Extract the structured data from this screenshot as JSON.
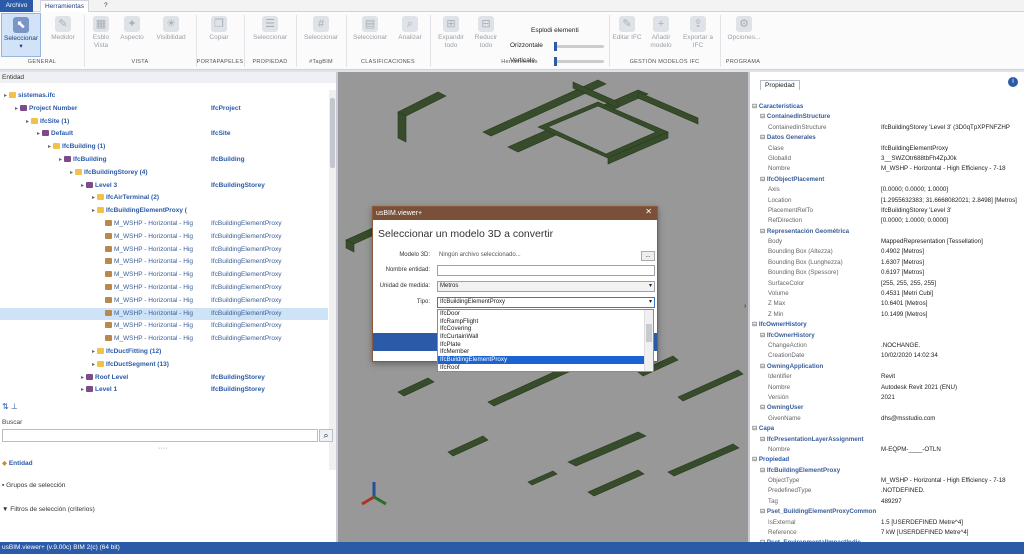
{
  "tabs": {
    "file": "Archivo",
    "tools": "Herramientas",
    "help": "?"
  },
  "ribbon": {
    "buttons": [
      {
        "label": "Seleccionar",
        "icon": "pointer-icon"
      },
      {
        "label": "Medidor",
        "icon": "ruler-icon"
      },
      {
        "label": "Esblo Vista",
        "icon": "eye-icon"
      },
      {
        "label": "Aspecto",
        "icon": "paint-icon"
      },
      {
        "label": "Visibilidad",
        "icon": "bulb-icon"
      },
      {
        "label": "Copiar",
        "icon": "copy-icon"
      },
      {
        "label": "Seleccionar",
        "icon": "list-icon"
      },
      {
        "label": "Seleccionar",
        "icon": "hash-icon"
      },
      {
        "label": "Seleccionar",
        "icon": "filter-icon"
      },
      {
        "label": "Analizar",
        "icon": "analyze-icon"
      },
      {
        "label": "Expandir todo",
        "icon": "expand-icon"
      },
      {
        "label": "Reducir todo",
        "icon": "collapse-icon"
      },
      {
        "label": "Editar IFC",
        "icon": "edit-icon"
      },
      {
        "label": "Añadir modelo",
        "icon": "add-model-icon"
      },
      {
        "label": "Exportar a IFC",
        "icon": "export-icon"
      },
      {
        "label": "Opciones...",
        "icon": "gear-icon"
      }
    ],
    "groups": [
      "GENERAL",
      "VISTA",
      "PORTAPAPELES",
      "PROPIEDAD",
      "#TagBIM",
      "CLASIFICACIONES",
      "Herramientas",
      "GESTIÓN MODELOS IFC",
      "PROGRAMA"
    ],
    "explode": {
      "title": "Esplodi elementi",
      "horizontal": "Orizzontale",
      "vertical": "Verticale"
    }
  },
  "left": {
    "header": "Entidad",
    "tree": [
      {
        "name": "sistemas.ifc",
        "type": "",
        "level": 0,
        "icon": "folder"
      },
      {
        "name": "Project Number",
        "type": "IfcProject",
        "level": 1,
        "icon": "project"
      },
      {
        "name": "IfcSite (1)",
        "type": "",
        "level": 2,
        "icon": "folder"
      },
      {
        "name": "Default",
        "type": "IfcSite",
        "level": 3,
        "icon": "project"
      },
      {
        "name": "IfcBuilding (1)",
        "type": "",
        "level": 4,
        "icon": "folder"
      },
      {
        "name": "IfcBuilding",
        "type": "IfcBuilding",
        "level": 5,
        "icon": "project"
      },
      {
        "name": "IfcBuildingStorey (4)",
        "type": "",
        "level": 6,
        "icon": "folder"
      },
      {
        "name": "Level 3",
        "type": "IfcBuildingStorey",
        "level": 7,
        "icon": "project"
      },
      {
        "name": "IfcAirTerminal (2)",
        "type": "",
        "level": 8,
        "icon": "folder"
      },
      {
        "name": "IfcBuildingElementProxy (",
        "type": "",
        "level": 8,
        "icon": "folder"
      },
      {
        "name": "M_WSHP - Horizontal - Hig",
        "type": "IfcBuildingElementProxy",
        "level": 9,
        "icon": "bldg"
      },
      {
        "name": "M_WSHP - Horizontal - Hig",
        "type": "IfcBuildingElementProxy",
        "level": 9,
        "icon": "bldg"
      },
      {
        "name": "M_WSHP - Horizontal - Hig",
        "type": "IfcBuildingElementProxy",
        "level": 9,
        "icon": "bldg"
      },
      {
        "name": "M_WSHP - Horizontal - Hig",
        "type": "IfcBuildingElementProxy",
        "level": 9,
        "icon": "bldg"
      },
      {
        "name": "M_WSHP - Horizontal - Hig",
        "type": "IfcBuildingElementProxy",
        "level": 9,
        "icon": "bldg"
      },
      {
        "name": "M_WSHP - Horizontal - Hig",
        "type": "IfcBuildingElementProxy",
        "level": 9,
        "icon": "bldg"
      },
      {
        "name": "M_WSHP - Horizontal - Hig",
        "type": "IfcBuildingElementProxy",
        "level": 9,
        "icon": "bldg"
      },
      {
        "name": "M_WSHP - Horizontal - Hig",
        "type": "IfcBuildingElementProxy",
        "level": 9,
        "icon": "bldg"
      },
      {
        "name": "M_WSHP - Horizontal - Hig",
        "type": "IfcBuildingElementProxy",
        "level": 9,
        "icon": "bldg"
      },
      {
        "name": "M_WSHP - Horizontal - Hig",
        "type": "IfcBuildingElementProxy",
        "level": 9,
        "icon": "bldg"
      },
      {
        "name": "IfcDuctFitting (12)",
        "type": "",
        "level": 8,
        "icon": "folder"
      },
      {
        "name": "IfcDuctSegment (13)",
        "type": "",
        "level": 8,
        "icon": "folder"
      },
      {
        "name": "Roof Level",
        "type": "IfcBuildingStorey",
        "level": 7,
        "icon": "project"
      },
      {
        "name": "Level 1",
        "type": "IfcBuildingStorey",
        "level": 7,
        "icon": "project"
      }
    ],
    "search_label": "Buscar",
    "sections": [
      "Entidad",
      "Grupos de selección",
      "Filtros de selección (criterios)"
    ]
  },
  "right": {
    "tab": "Propiedad",
    "rows": [
      {
        "k": "Características",
        "v": "",
        "kind": "cat",
        "ind": 0
      },
      {
        "k": "ContainedInStructure",
        "v": "",
        "kind": "sub",
        "ind": 1
      },
      {
        "k": "ContainedInStructure",
        "v": "IfcBuildingStorey 'Level 3' (3D0qTpXPFNFZHP",
        "kind": "leaf",
        "ind": 2
      },
      {
        "k": "Datos Generales",
        "v": "",
        "kind": "sub",
        "ind": 1
      },
      {
        "k": "Clase",
        "v": "IfcBuildingElementProxy",
        "kind": "leaf",
        "ind": 2
      },
      {
        "k": "GlobalId",
        "v": "3__SWZOtr688tbFh4ZpJ0k",
        "kind": "leaf",
        "ind": 2
      },
      {
        "k": "Nombre",
        "v": "M_WSHP - Horizontal - High Efficiency - 7-18",
        "kind": "leaf",
        "ind": 2
      },
      {
        "k": "IfcObjectPlacement",
        "v": "",
        "kind": "sub",
        "ind": 1
      },
      {
        "k": "Axis",
        "v": "[0.0000; 0.0000; 1.0000]",
        "kind": "leaf",
        "ind": 2
      },
      {
        "k": "Location",
        "v": "[1.2955632383; 31.6668082021; 2.8498] [Metros]",
        "kind": "leaf",
        "ind": 2
      },
      {
        "k": "PlacementRelTo",
        "v": "IfcBuildingStorey 'Level 3'",
        "kind": "leaf",
        "ind": 2
      },
      {
        "k": "RefDirection",
        "v": "[0.0000; 1.0000; 0.0000]",
        "kind": "leaf",
        "ind": 2
      },
      {
        "k": "Representación Geométrica",
        "v": "",
        "kind": "sub",
        "ind": 1
      },
      {
        "k": "Body",
        "v": "MappedRepresentation [Tessellation]",
        "kind": "leaf",
        "ind": 2
      },
      {
        "k": "Bounding Box (Altezza)",
        "v": "0.4902 [Metros]",
        "kind": "leaf",
        "ind": 2
      },
      {
        "k": "Bounding Box (Lunghezza)",
        "v": "1.6307 [Metros]",
        "kind": "leaf",
        "ind": 2
      },
      {
        "k": "Bounding Box (Spessore)",
        "v": "0.6197 [Metros]",
        "kind": "leaf",
        "ind": 2
      },
      {
        "k": "SurfaceColor",
        "v": "[255, 255, 255, 255]",
        "kind": "leaf",
        "ind": 2
      },
      {
        "k": "Volume",
        "v": "0.4531 [Metri Cubi]",
        "kind": "leaf",
        "ind": 2
      },
      {
        "k": "Z Max",
        "v": "10.6401 [Metros]",
        "kind": "leaf",
        "ind": 2
      },
      {
        "k": "Z Min",
        "v": "10.1499 [Metros]",
        "kind": "leaf",
        "ind": 2
      },
      {
        "k": "IfcOwnerHistory",
        "v": "",
        "kind": "cat",
        "ind": 0
      },
      {
        "k": "IfcOwnerHistory",
        "v": "",
        "kind": "sub",
        "ind": 1
      },
      {
        "k": "ChangeAction",
        "v": ".NOCHANGE.",
        "kind": "leaf",
        "ind": 2
      },
      {
        "k": "CreationDate",
        "v": "10/02/2020 14:02:34",
        "kind": "leaf",
        "ind": 2
      },
      {
        "k": "OwningApplication",
        "v": "",
        "kind": "sub",
        "ind": 1
      },
      {
        "k": "Identifier",
        "v": "Revit",
        "kind": "leaf",
        "ind": 2
      },
      {
        "k": "Nombre",
        "v": "Autodesk Revit 2021 (ENU)",
        "kind": "leaf",
        "ind": 2
      },
      {
        "k": "Versión",
        "v": "2021",
        "kind": "leaf",
        "ind": 2
      },
      {
        "k": "OwningUser",
        "v": "",
        "kind": "sub",
        "ind": 1
      },
      {
        "k": "GivenName",
        "v": "dhs@msstudio.com",
        "kind": "leaf",
        "ind": 2
      },
      {
        "k": "Capa",
        "v": "",
        "kind": "cat",
        "ind": 0
      },
      {
        "k": "IfcPresentationLayerAssignment",
        "v": "",
        "kind": "sub",
        "ind": 1
      },
      {
        "k": "Nombre",
        "v": "M-EQPM-____-OTLN",
        "kind": "leaf",
        "ind": 2
      },
      {
        "k": "Propiedad",
        "v": "",
        "kind": "cat",
        "ind": 0
      },
      {
        "k": "IfcBuildingElementProxy",
        "v": "",
        "kind": "sub",
        "ind": 1
      },
      {
        "k": "ObjectType",
        "v": "M_WSHP - Horizontal - High Efficiency - 7-18",
        "kind": "leaf",
        "ind": 2
      },
      {
        "k": "PredefinedType",
        "v": ".NOTDEFINED.",
        "kind": "leaf",
        "ind": 2
      },
      {
        "k": "Tag",
        "v": "489297",
        "kind": "leaf",
        "ind": 2
      },
      {
        "k": "Pset_BuildingElementProxyCommon",
        "v": "",
        "kind": "sub",
        "ind": 1
      },
      {
        "k": "IsExternal",
        "v": "1.5 [USERDEFINED Metre^4]",
        "kind": "leaf",
        "ind": 2
      },
      {
        "k": "Reference",
        "v": "7 kW [USERDEFINED Metre^4]",
        "kind": "leaf",
        "ind": 2
      },
      {
        "k": "Pset_EnvironmentalImpactIndic",
        "v": "",
        "kind": "sub",
        "ind": 1
      }
    ]
  },
  "dialog": {
    "title": "usBIM.viewer+",
    "heading": "Seleccionar un modelo 3D a convertir",
    "model_label": "Modelo 3D:",
    "model_value": "Ningún archivo seleccionado...",
    "browse": "...",
    "name_label": "Nombre entidad:",
    "name_value": "",
    "unit_label": "Unidad de medida:",
    "unit_value": "Metros",
    "type_label": "Tipo:",
    "type_value": "IfcBuildingElementProxy"
  },
  "type_list": [
    "IfcDoor",
    "IfcRampFlight",
    "IfcCovering",
    "IfcCurtainWall",
    "IfcPlate",
    "IfcMember",
    "IfcBuildingElementProxy",
    "IfcRoof"
  ],
  "type_list_selected": "IfcBuildingElementProxy",
  "status": "usBIM.viewer+ (v.9.00c)  BIM 2(c) (64 bit)"
}
